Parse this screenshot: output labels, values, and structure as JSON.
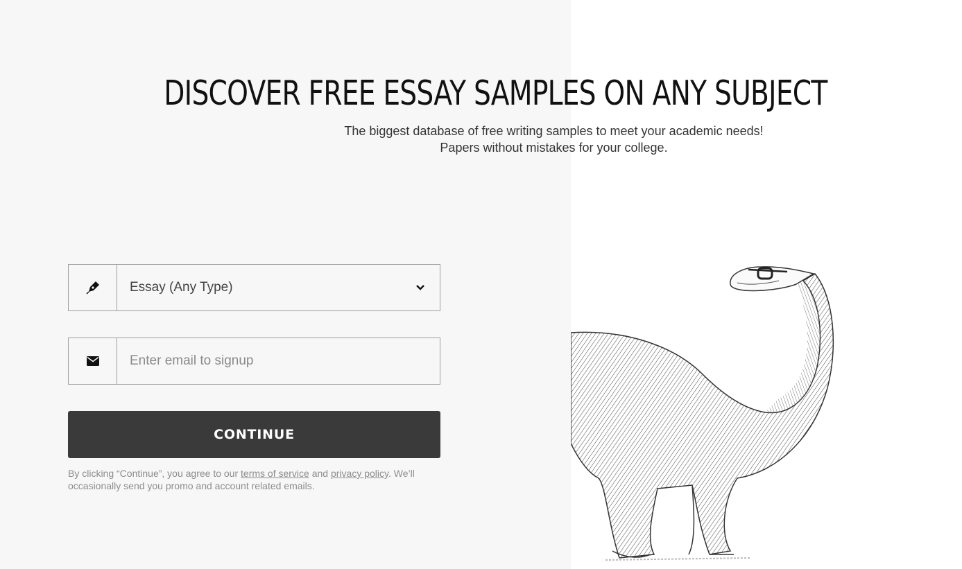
{
  "hero": {
    "title": "DISCOVER FREE ESSAY SAMPLES ON ANY SUBJECT",
    "subtitle_line1": "The biggest database of free writing samples to meet your academic needs!",
    "subtitle_line2": "Papers without mistakes for your college."
  },
  "form": {
    "paper_type": {
      "icon": "pen-nib-icon",
      "selected": "Essay (Any Type)"
    },
    "email": {
      "icon": "envelope-icon",
      "value": "",
      "placeholder": "Enter email to signup"
    },
    "continue_label": "CONTINUE",
    "legal": {
      "prefix": "By clicking “Continue”, you agree to our ",
      "terms_link": "terms of service",
      "middle": " and ",
      "privacy_link": "privacy policy",
      "suffix": ". We’ll occasionally send you promo and account related emails."
    }
  },
  "colors": {
    "left_background": "#f7f7f7",
    "button_background": "#3a3a3a",
    "border": "#9e9e9e"
  }
}
